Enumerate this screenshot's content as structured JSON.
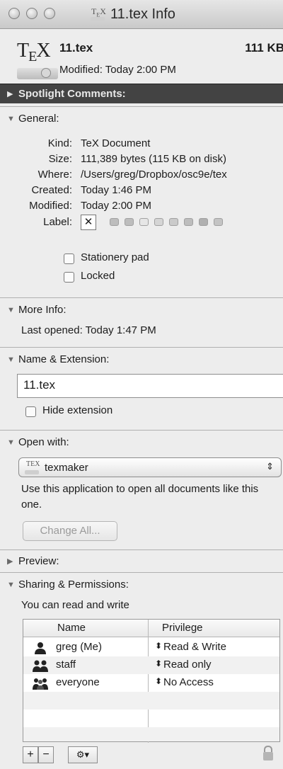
{
  "window": {
    "title": "11.tex Info"
  },
  "header": {
    "icon_text": "TEX",
    "filename": "11.tex",
    "size_short": "111 KB",
    "modified_line": "Modified: Today 2:00 PM"
  },
  "spotlight": {
    "title": "Spotlight Comments:"
  },
  "general": {
    "title": "General:",
    "kind_label": "Kind:",
    "kind_value": "TeX Document",
    "size_label": "Size:",
    "size_value": "111,389 bytes (115 KB on disk)",
    "where_label": "Where:",
    "where_value": "/Users/greg/Dropbox/osc9e/tex",
    "created_label": "Created:",
    "created_value": "Today 1:46 PM",
    "modified_label": "Modified:",
    "modified_value": "Today 2:00 PM",
    "label_label": "Label:",
    "label_selected": "✕",
    "stationery_label": "Stationery pad",
    "locked_label": "Locked"
  },
  "more_info": {
    "title": "More Info:",
    "last_opened": "Last opened: Today 1:47 PM"
  },
  "name_ext": {
    "title": "Name & Extension:",
    "name_value": "11.tex",
    "hide_ext_label": "Hide extension"
  },
  "open_with": {
    "title": "Open with:",
    "app_icon_text": "TEX",
    "app": "texmaker",
    "description": "Use this application to open all documents like this one.",
    "change_all": "Change All..."
  },
  "preview": {
    "title": "Preview:"
  },
  "sharing": {
    "title": "Sharing & Permissions:",
    "summary": "You can read and write",
    "col_name": "Name",
    "col_privilege": "Privilege",
    "rows": [
      {
        "name": "greg (Me)",
        "privilege": "Read & Write",
        "icon": "single-user-icon"
      },
      {
        "name": "staff",
        "privilege": "Read only",
        "icon": "group-icon"
      },
      {
        "name": "everyone",
        "privilege": "No Access",
        "icon": "everyone-icon"
      }
    ],
    "add": "+",
    "remove": "−",
    "action": "⚙▾",
    "lock_icon": "lock-icon"
  }
}
